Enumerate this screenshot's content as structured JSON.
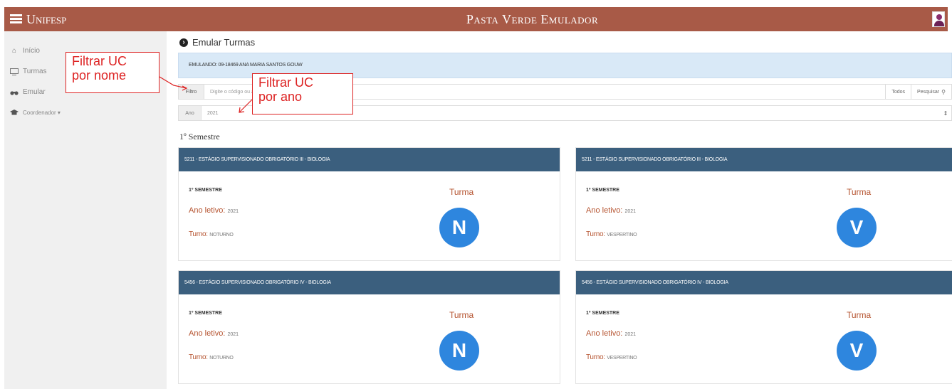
{
  "header": {
    "brand": "Unifesp",
    "title": "Pasta Verde Emulador",
    "menu_icon": "hamburger-icon",
    "avatar_icon": "user-avatar-icon",
    "bg_color": "#a85a47"
  },
  "sidebar": {
    "items": [
      {
        "label": "Início",
        "icon": "home-icon"
      },
      {
        "label": "Turmas",
        "icon": "classroom-icon"
      },
      {
        "label": "Emular",
        "icon": "binoculars-icon"
      },
      {
        "label": "Coordenador ▾",
        "icon": "graduation-cap-icon"
      }
    ]
  },
  "main": {
    "title": "Emular Turmas",
    "emulating": "EMULANDO: 09-18469 ANA MARIA SANTOS GOUW",
    "filter": {
      "addon": "Filtro",
      "placeholder": "Digite o código ou a descrição da matéria para pesquisar",
      "all_button": "Todos",
      "search_button": "Pesquisar"
    },
    "year": {
      "addon": "Ano",
      "value": "2021"
    },
    "semester_heading": "1º Semestre",
    "cards": [
      {
        "title": "5211 - ESTÁGIO SUPERVISIONADO OBRIGATÓRIO III - BIOLOGIA",
        "semester": "1º SEMESTRE",
        "ano_label": "Ano letivo:",
        "ano_value": "2021",
        "turno_label": "Turno:",
        "turno_value": "NOTURNO",
        "turma_label": "Turma",
        "turma_value": "N"
      },
      {
        "title": "5211 - ESTÁGIO SUPERVISIONADO OBRIGATÓRIO III - BIOLOGIA",
        "semester": "1º SEMESTRE",
        "ano_label": "Ano letivo:",
        "ano_value": "2021",
        "turno_label": "Turno:",
        "turno_value": "VESPERTINO",
        "turma_label": "Turma",
        "turma_value": "V"
      },
      {
        "title": "5456 - ESTÁGIO SUPERVISIONADO OBRIGATÓRIO IV - BIOLOGIA",
        "semester": "1º SEMESTRE",
        "ano_label": "Ano letivo:",
        "ano_value": "2021",
        "turno_label": "Turno:",
        "turno_value": "NOTURNO",
        "turma_label": "Turma",
        "turma_value": "N"
      },
      {
        "title": "5456 - ESTÁGIO SUPERVISIONADO OBRIGATÓRIO IV - BIOLOGIA",
        "semester": "1º SEMESTRE",
        "ano_label": "Ano letivo:",
        "ano_value": "2021",
        "turno_label": "Turno:",
        "turno_value": "VESPERTINO",
        "turma_label": "Turma",
        "turma_value": "V"
      }
    ]
  },
  "annotations": {
    "by_name": [
      "Filtrar UC",
      "por nome"
    ],
    "by_year": [
      "Filtrar UC",
      "por ano"
    ],
    "color": "#dd2222"
  }
}
